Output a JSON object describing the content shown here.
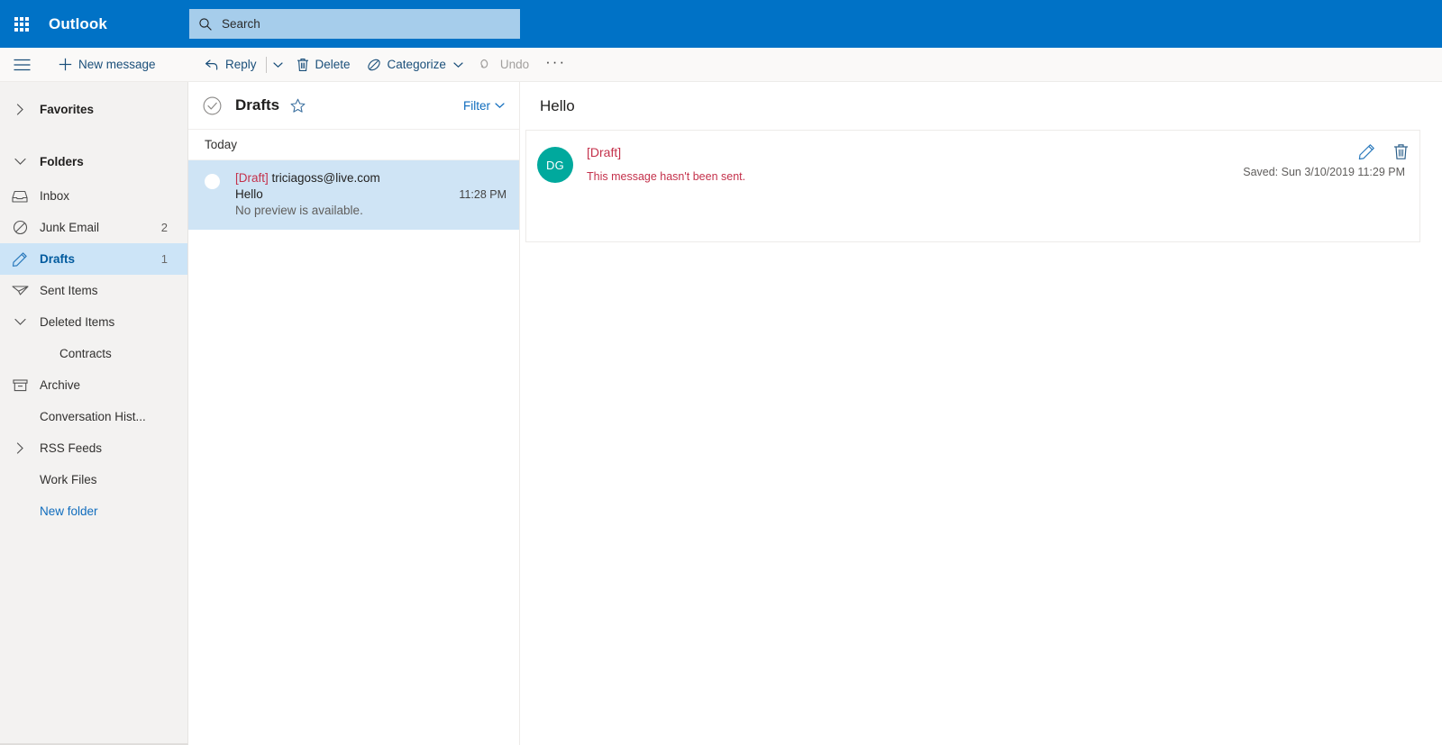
{
  "header": {
    "brand": "Outlook",
    "app_launcher_icon": "waffle-grid-icon",
    "search": {
      "placeholder": "Search",
      "value": "",
      "icon": "search-icon"
    },
    "background_color": "#0072c6",
    "search_background_color": "#a6cdeb"
  },
  "toolbar": {
    "menu_icon": "hamburger-icon",
    "new_message_label": "New message",
    "new_message_icon": "plus-icon",
    "reply_label": "Reply",
    "reply_icon": "reply-arrow-icon",
    "reply_caret_icon": "chevron-down-icon",
    "delete_label": "Delete",
    "delete_icon": "trash-icon",
    "categorize_label": "Categorize",
    "categorize_icon": "tag-slash-icon",
    "categorize_caret_icon": "chevron-down-icon",
    "undo_label": "Undo",
    "undo_icon": "undo-arrow-icon",
    "undo_disabled": true,
    "more_label": "···",
    "accent_color": "#1a4f7a",
    "disabled_color": "#a19f9d"
  },
  "sidebar": {
    "favorites": {
      "label": "Favorites",
      "chevron": "chevron-right-icon",
      "expanded": false
    },
    "folders_group": {
      "label": "Folders",
      "chevron": "chevron-down-icon",
      "expanded": true
    },
    "items": [
      {
        "label": "Inbox",
        "icon": "inbox-icon",
        "count": "",
        "selected": false,
        "sub": false,
        "chevron": ""
      },
      {
        "label": "Junk Email",
        "icon": "block-circle-icon",
        "count": "2",
        "selected": false,
        "sub": false,
        "chevron": ""
      },
      {
        "label": "Drafts",
        "icon": "pencil-icon",
        "count": "1",
        "selected": true,
        "sub": false,
        "chevron": ""
      },
      {
        "label": "Sent Items",
        "icon": "paper-plane-icon",
        "count": "",
        "selected": false,
        "sub": false,
        "chevron": ""
      },
      {
        "label": "Deleted Items",
        "icon": "",
        "count": "",
        "selected": false,
        "sub": false,
        "chevron": "chevron-down-icon"
      },
      {
        "label": "Contracts",
        "icon": "",
        "count": "",
        "selected": false,
        "sub": true,
        "chevron": ""
      },
      {
        "label": "Archive",
        "icon": "archive-box-icon",
        "count": "",
        "selected": false,
        "sub": false,
        "chevron": ""
      },
      {
        "label": "Conversation Hist...",
        "icon": "",
        "count": "",
        "selected": false,
        "sub": false,
        "chevron": ""
      },
      {
        "label": "RSS Feeds",
        "icon": "",
        "count": "",
        "selected": false,
        "sub": false,
        "chevron": "chevron-right-icon"
      },
      {
        "label": "Work Files",
        "icon": "",
        "count": "",
        "selected": false,
        "sub": false,
        "chevron": ""
      }
    ],
    "new_folder_label": "New folder",
    "selected_background_color": "#cce4f7",
    "selected_text_color": "#005a9e",
    "background_color": "#f3f2f1"
  },
  "message_list": {
    "select_all_icon": "check-circle-icon",
    "title": "Drafts",
    "star_icon": "star-outline-icon",
    "filter_label": "Filter",
    "filter_caret_icon": "chevron-down-icon",
    "day_group": "Today",
    "messages": [
      {
        "draft_tag": "[Draft]",
        "sender": "triciagoss@live.com",
        "subject": "Hello",
        "time": "11:28 PM",
        "preview": "No preview is available.",
        "selected": true,
        "unread_dot": "unread-dot"
      }
    ],
    "selected_background_color": "#cfe4f5",
    "draft_tag_color": "#c4314b"
  },
  "reading_pane": {
    "subject": "Hello",
    "avatar_initials": "DG",
    "avatar_color": "#00a99d",
    "draft_tag": "[Draft]",
    "notice": "This message hasn't been sent.",
    "saved_stamp": "Saved: Sun 3/10/2019 11:29 PM",
    "edit_icon": "pencil-icon",
    "delete_icon": "trash-icon"
  }
}
